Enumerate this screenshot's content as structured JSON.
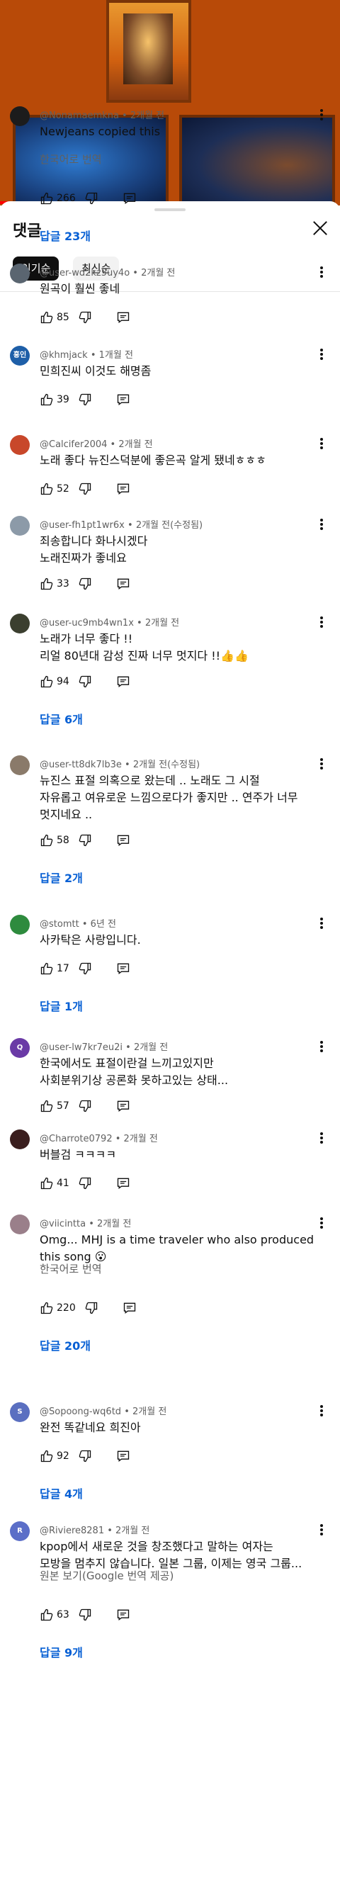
{
  "sheet": {
    "title": "댓글",
    "sort_top": "인기순",
    "sort_newest": "최신순"
  },
  "comments": [
    {
      "author": "@Nonamaemkna",
      "time": "2개월 전",
      "text": "Newjeans copied this",
      "translate": "한국어로 번역",
      "likes": "266",
      "replies": "답글 23개",
      "avatar_color": "#1c1c1c",
      "avatar_text": ""
    },
    {
      "author": "@user-wd2kz5uy4o",
      "time": "2개월 전",
      "text": "원곡이 훨씬 좋네",
      "translate": "",
      "likes": "85",
      "replies": "",
      "avatar_color": "#5a6570",
      "avatar_text": ""
    },
    {
      "author": "@khmjack",
      "time": "1개월 전",
      "text": "민희진씨 이것도 해명좀",
      "translate": "",
      "likes": "39",
      "replies": "",
      "avatar_color": "#1e5fa8",
      "avatar_text": "홍인"
    },
    {
      "author": "@Calcifer2004",
      "time": "2개월 전",
      "text": "노래 좋다 뉴진스덕분에 좋은곡 알게 됐네ㅎㅎㅎ",
      "translate": "",
      "likes": "52",
      "replies": "",
      "avatar_color": "#c8472a",
      "avatar_text": ""
    },
    {
      "author": "@user-fh1pt1wr6x",
      "time": "2개월 전(수정됨)",
      "text": "죄송합니다 화나시겠다\n노래진짜가 좋네요",
      "translate": "",
      "likes": "33",
      "replies": "",
      "avatar_color": "#8c9aa8",
      "avatar_text": ""
    },
    {
      "author": "@user-uc9mb4wn1x",
      "time": "2개월 전",
      "text": "노래가 너무 좋다 !!\n리얼 80년대 감성 진짜 너무 멋지다 !!👍👍",
      "translate": "",
      "likes": "94",
      "replies": "답글 6개",
      "avatar_color": "#3b3f2f",
      "avatar_text": ""
    },
    {
      "author": "@user-tt8dk7lb3e",
      "time": "2개월 전(수정됨)",
      "text": "뉴진스 표절 의혹으로 왔는데 .. 노래도 그 시절\n자유롭고 여유로운 느낌으로다가 좋지만 .. 연주가 너무\n멋지네요 ..",
      "translate": "",
      "likes": "58",
      "replies": "답글 2개",
      "avatar_color": "#8a7a6a",
      "avatar_text": ""
    },
    {
      "author": "@stomtt",
      "time": "6년 전",
      "text": "사카탁은 사랑입니다.",
      "translate": "",
      "likes": "17",
      "replies": "답글 1개",
      "avatar_color": "#2e8b3e",
      "avatar_text": ""
    },
    {
      "author": "@user-lw7kr7eu2i",
      "time": "2개월 전",
      "text": "한국에서도 표절이란걸 느끼고있지만\n사회분위기상 공론화 못하고있는 상태...",
      "translate": "",
      "likes": "57",
      "replies": "",
      "avatar_color": "#6a3aa6",
      "avatar_text": "Q"
    },
    {
      "author": "@Charrote0792",
      "time": "2개월 전",
      "text": "버블검 ㅋㅋㅋㅋ",
      "translate": "",
      "likes": "41",
      "replies": "",
      "avatar_color": "#3a1e1e",
      "avatar_text": ""
    },
    {
      "author": "@viicintta",
      "time": "2개월 전",
      "text": "Omg... MHJ is a time traveler who also produced\nthis song 😮",
      "translate": "한국어로 번역",
      "likes": "220",
      "replies": "답글 20개",
      "avatar_color": "#9a7f8a",
      "avatar_text": ""
    },
    {
      "author": "@Sopoong-wq6td",
      "time": "2개월 전",
      "text": "완전 똑같네요 희진아",
      "translate": "",
      "likes": "92",
      "replies": "답글 4개",
      "avatar_color": "#5a6fc0",
      "avatar_text": "S"
    },
    {
      "author": "@Riviere8281",
      "time": "2개월 전",
      "text": "kpop에서 새로운 것을 창조했다고 말하는 여자는\n모방을 멈추지 않습니다. 일본 그룹, 이제는 영국 그룹...",
      "translate": "원본 보기(Google 번역 제공)",
      "likes": "63",
      "replies": "답글 9개",
      "avatar_color": "#5b6ec8",
      "avatar_text": "R"
    }
  ]
}
